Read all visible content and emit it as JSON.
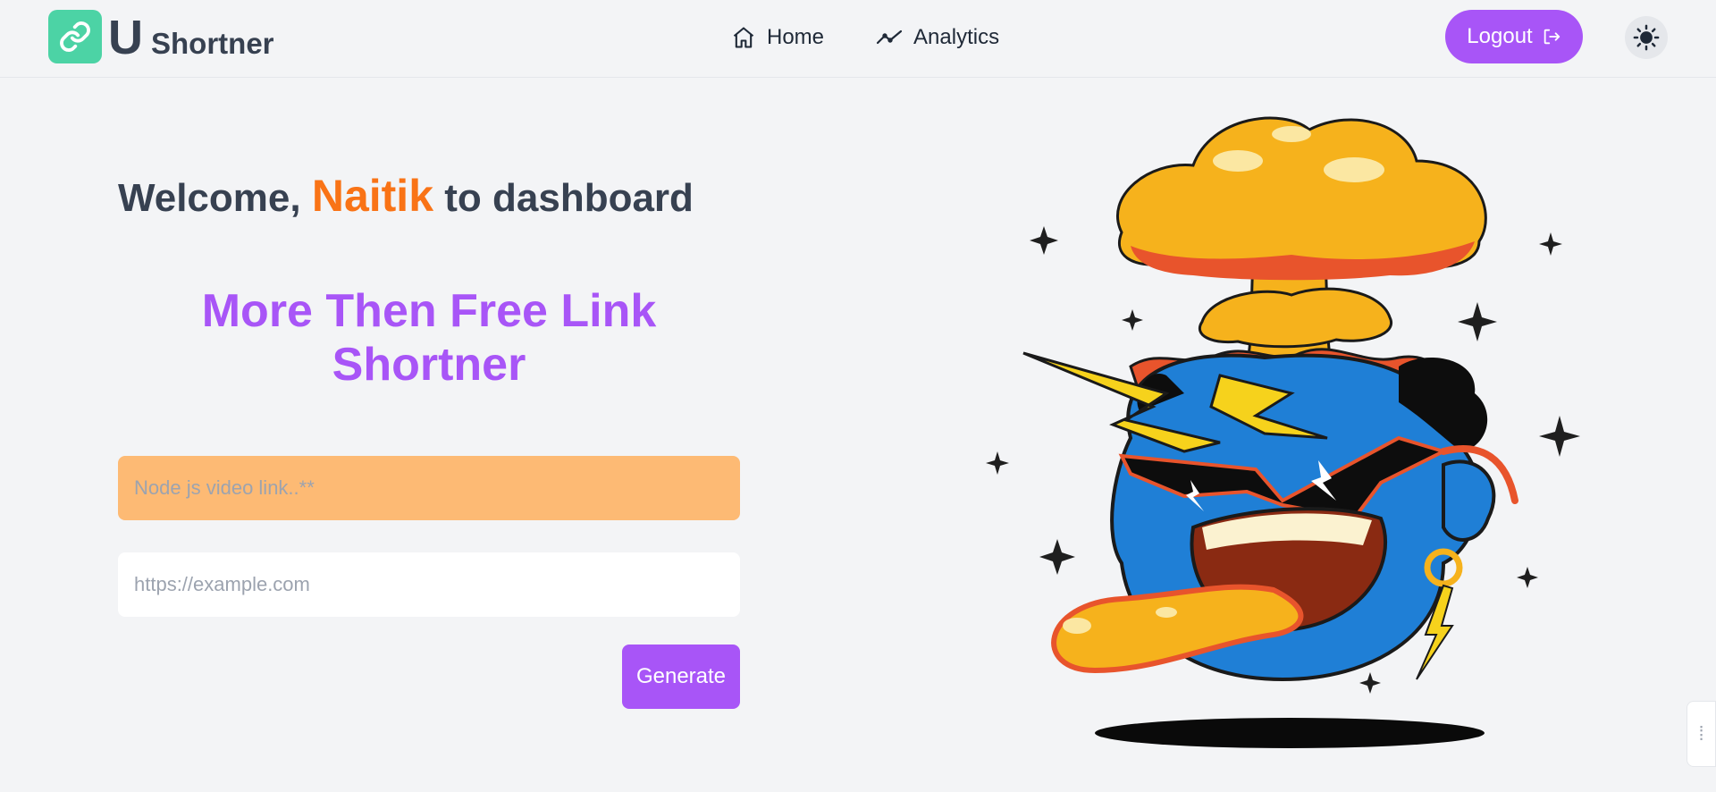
{
  "brand": {
    "letter": "U",
    "name": "Shortner",
    "logo_icon": "link-icon"
  },
  "nav": {
    "items": [
      {
        "label": "Home",
        "icon": "home-icon"
      },
      {
        "label": "Analytics",
        "icon": "trend-line-icon"
      }
    ],
    "logout_label": "Logout",
    "theme_icon": "sun-icon"
  },
  "main": {
    "welcome_prefix": "Welcome,",
    "user_name": "Naitik",
    "welcome_suffix": "to dashboard",
    "tagline": "More Then Free Link Shortner",
    "title_placeholder": "Node js video link..**",
    "url_placeholder": "https://example.com",
    "generate_label": "Generate"
  },
  "colors": {
    "accent": "#a855f7",
    "highlight": "#f97316",
    "brand_logo": "#4cd3a5",
    "title_input_bg": "#fdba74"
  }
}
